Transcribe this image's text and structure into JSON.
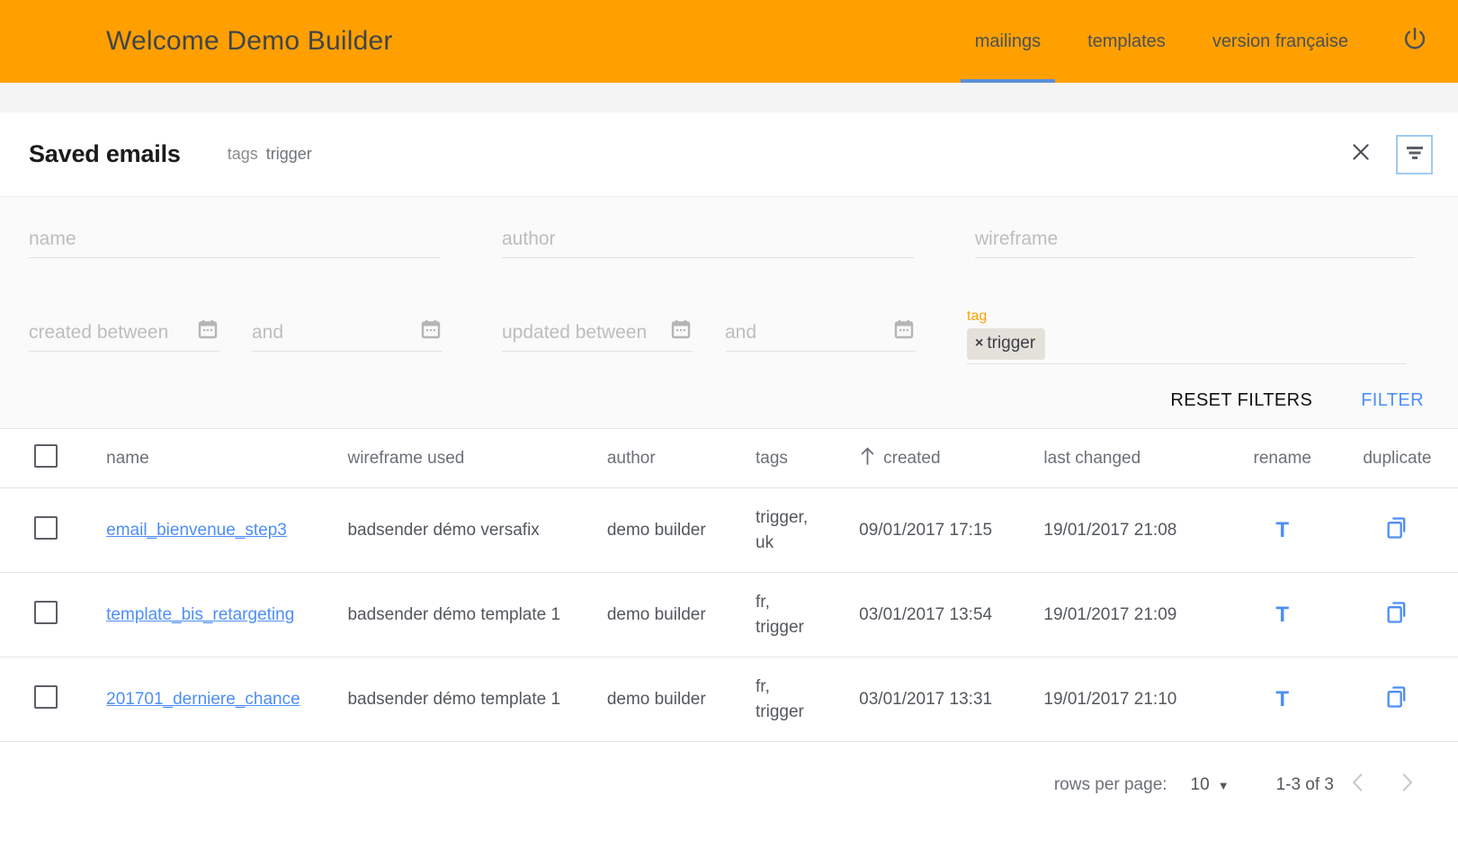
{
  "header": {
    "brand": "Welcome Demo Builder",
    "nav": [
      {
        "label": "mailings",
        "active": true
      },
      {
        "label": "templates",
        "active": false
      },
      {
        "label": "version française",
        "active": false
      }
    ],
    "power_icon": "power-icon",
    "background_color": "#ffa000"
  },
  "title_bar": {
    "title": "Saved emails",
    "meta_label": "tags",
    "meta_value": "trigger",
    "close_icon": "close-icon",
    "filter_icon": "filter-icon"
  },
  "filters": {
    "name": {
      "placeholder": "name",
      "value": ""
    },
    "author": {
      "placeholder": "author",
      "value": ""
    },
    "wireframe": {
      "placeholder": "wireframe",
      "value": ""
    },
    "created_from": {
      "placeholder": "created between",
      "value": ""
    },
    "created_to": {
      "placeholder": "and",
      "value": ""
    },
    "updated_from": {
      "placeholder": "updated between",
      "value": ""
    },
    "updated_to": {
      "placeholder": "and",
      "value": ""
    },
    "tag": {
      "label": "tag",
      "label_color": "#ffa000",
      "chips": [
        {
          "remove": "×",
          "label": "trigger"
        }
      ]
    },
    "reset_label": "RESET FILTERS",
    "apply_label": "FILTER",
    "apply_color": "#4d8ef7"
  },
  "table": {
    "columns": [
      "name",
      "wireframe used",
      "author",
      "tags",
      "created",
      "last changed",
      "rename",
      "duplicate"
    ],
    "sorted_column": "created",
    "sort_direction": "asc",
    "rows": [
      {
        "name": "email_bienvenue_step3",
        "wireframe": "badsender démo versafix",
        "author": "demo builder",
        "tags": "trigger,\nuk",
        "created": "09/01/2017 17:15",
        "last_changed": "19/01/2017 21:08",
        "rename_icon": "T",
        "duplicate_icon": "copy-icon"
      },
      {
        "name": "template_bis_retargeting",
        "wireframe": "badsender démo template 1",
        "author": "demo builder",
        "tags": "fr,\ntrigger",
        "created": "03/01/2017 13:54",
        "last_changed": "19/01/2017 21:09",
        "rename_icon": "T",
        "duplicate_icon": "copy-icon"
      },
      {
        "name": "201701_derniere_chance",
        "wireframe": "badsender démo template 1",
        "author": "demo builder",
        "tags": "fr,\ntrigger",
        "created": "03/01/2017 13:31",
        "last_changed": "19/01/2017 21:10",
        "rename_icon": "T",
        "duplicate_icon": "copy-icon"
      }
    ]
  },
  "pagination": {
    "rows_per_page_label": "rows per page:",
    "rows_per_page_value": "10",
    "caret": "▼",
    "range": "1-3 of 3",
    "prev_icon": "chevron-left-icon",
    "next_icon": "chevron-right-icon"
  }
}
